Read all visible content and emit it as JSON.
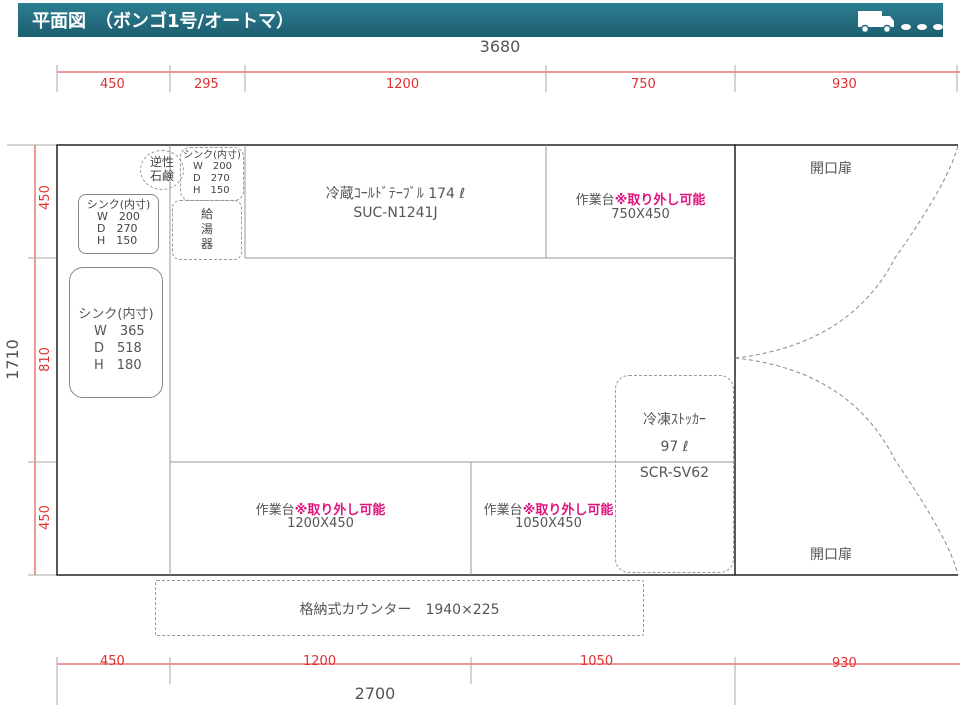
{
  "header": {
    "title": "平面図　（ボンゴ1号/オートマ）",
    "icon": "truck-icon"
  },
  "dims_top": {
    "total": "3680",
    "segments": [
      "450",
      "295",
      "1200",
      "750",
      "930"
    ]
  },
  "dims_bottom": {
    "total": "2700",
    "segments": [
      "450",
      "1200",
      "1050",
      "930"
    ]
  },
  "dims_left": {
    "total": "1710",
    "segments": [
      "450",
      "810",
      "450"
    ]
  },
  "sink_small": {
    "title": "シンク(内寸)",
    "w": "W　200",
    "d": "D　270",
    "h": "H　150"
  },
  "sink_top": {
    "title": "シンク(内寸)",
    "w": "W　200",
    "d": "D　270",
    "h": "H　150"
  },
  "sink_large": {
    "title": "シンク(内寸)",
    "w": "W　365",
    "d": "D　518",
    "h": "H　180"
  },
  "softener": {
    "line1": "逆性",
    "line2": "石鹸"
  },
  "water_heater": {
    "chars": [
      "給",
      "湯",
      "器"
    ]
  },
  "fridge": {
    "name": "冷蔵ｺｰﾙﾄﾞﾃｰﾌﾞﾙ  174 ℓ",
    "model": "SUC-N1241J"
  },
  "worktable_top": {
    "name": "作業台",
    "note": "※取り外し可能",
    "size": "750X450"
  },
  "worktable_bottom_left": {
    "name": "作業台",
    "note": "※取り外し可能",
    "size": "1200X450"
  },
  "worktable_bottom_mid": {
    "name": "作業台",
    "note": "※取り外し可能",
    "size": "1050X450"
  },
  "freezer": {
    "name": "冷凍ｽﾄｯｶｰ",
    "capacity": "97 ℓ",
    "model": "SCR-SV62"
  },
  "door_top": "開口扉",
  "door_bottom": "開口扉",
  "storage_counter": "格納式カウンター　1940×225",
  "colors": {
    "header": "#1f6b7f",
    "dimension": "#e03030",
    "highlight": "#e0147e"
  }
}
